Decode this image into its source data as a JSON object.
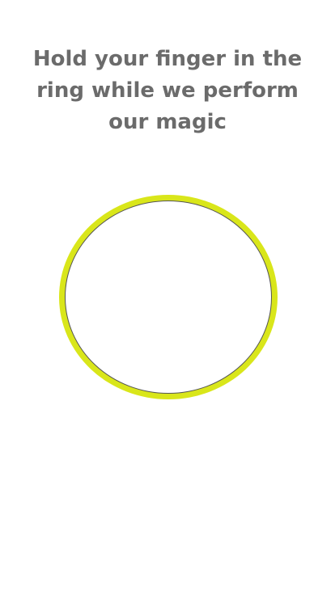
{
  "instruction": {
    "text": "Hold your finger in the ring  while we perform our magic"
  },
  "ring": {
    "color": "#d9e61a",
    "inner_border_color": "#555555"
  },
  "colors": {
    "text": "#6b6b6b",
    "background": "#ffffff"
  }
}
